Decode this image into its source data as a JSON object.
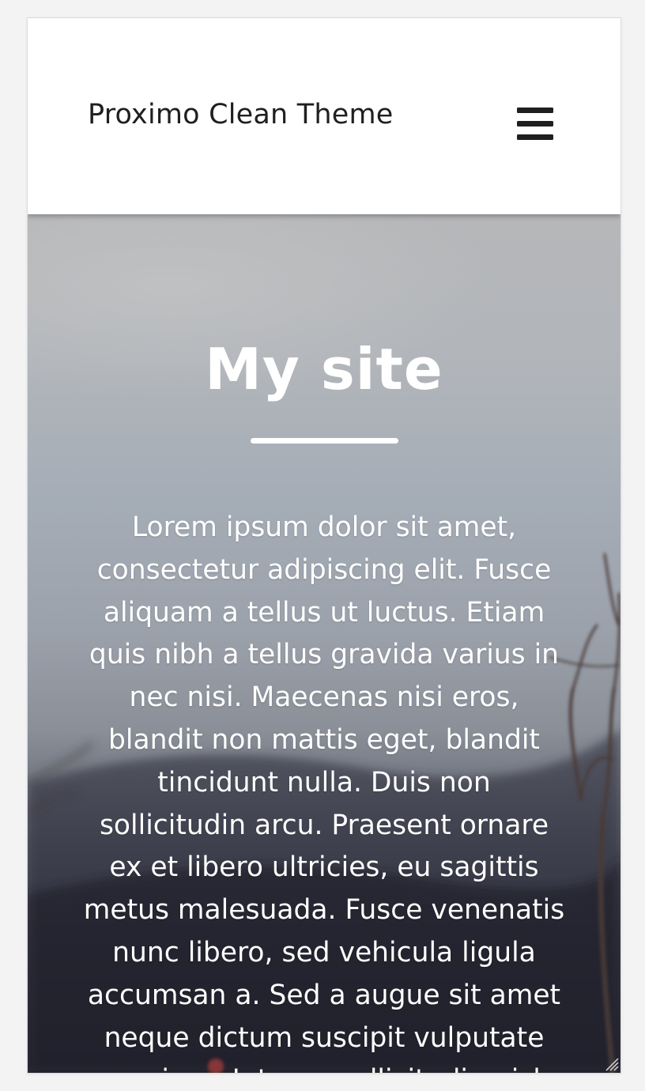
{
  "header": {
    "site_title": "Proximo Clean Theme",
    "menu_icon": "hamburger-menu-icon"
  },
  "hero": {
    "title": "My site",
    "body": "Lorem ipsum dolor sit amet, consectetur adipiscing elit. Fusce aliquam a tellus ut luctus. Etiam quis nibh a tellus gravida varius in nec nisi. Maecenas nisi eros, blandit non mattis eget, blandit tincidunt nulla. Duis non sollicitudin arcu. Praesent ornare ex et libero ultricies, eu sagittis metus malesuada. Fusce venenatis nunc libero, sed vehicula ligula accumsan a. Sed a augue sit amet neque dictum suscipit vulputate eu risus. Integer sollicitudin nisl"
  },
  "colors": {
    "header_bg": "#ffffff",
    "title_text": "#1f1f1f",
    "hero_text": "#ffffff",
    "page_bg": "#f3f3f3"
  }
}
